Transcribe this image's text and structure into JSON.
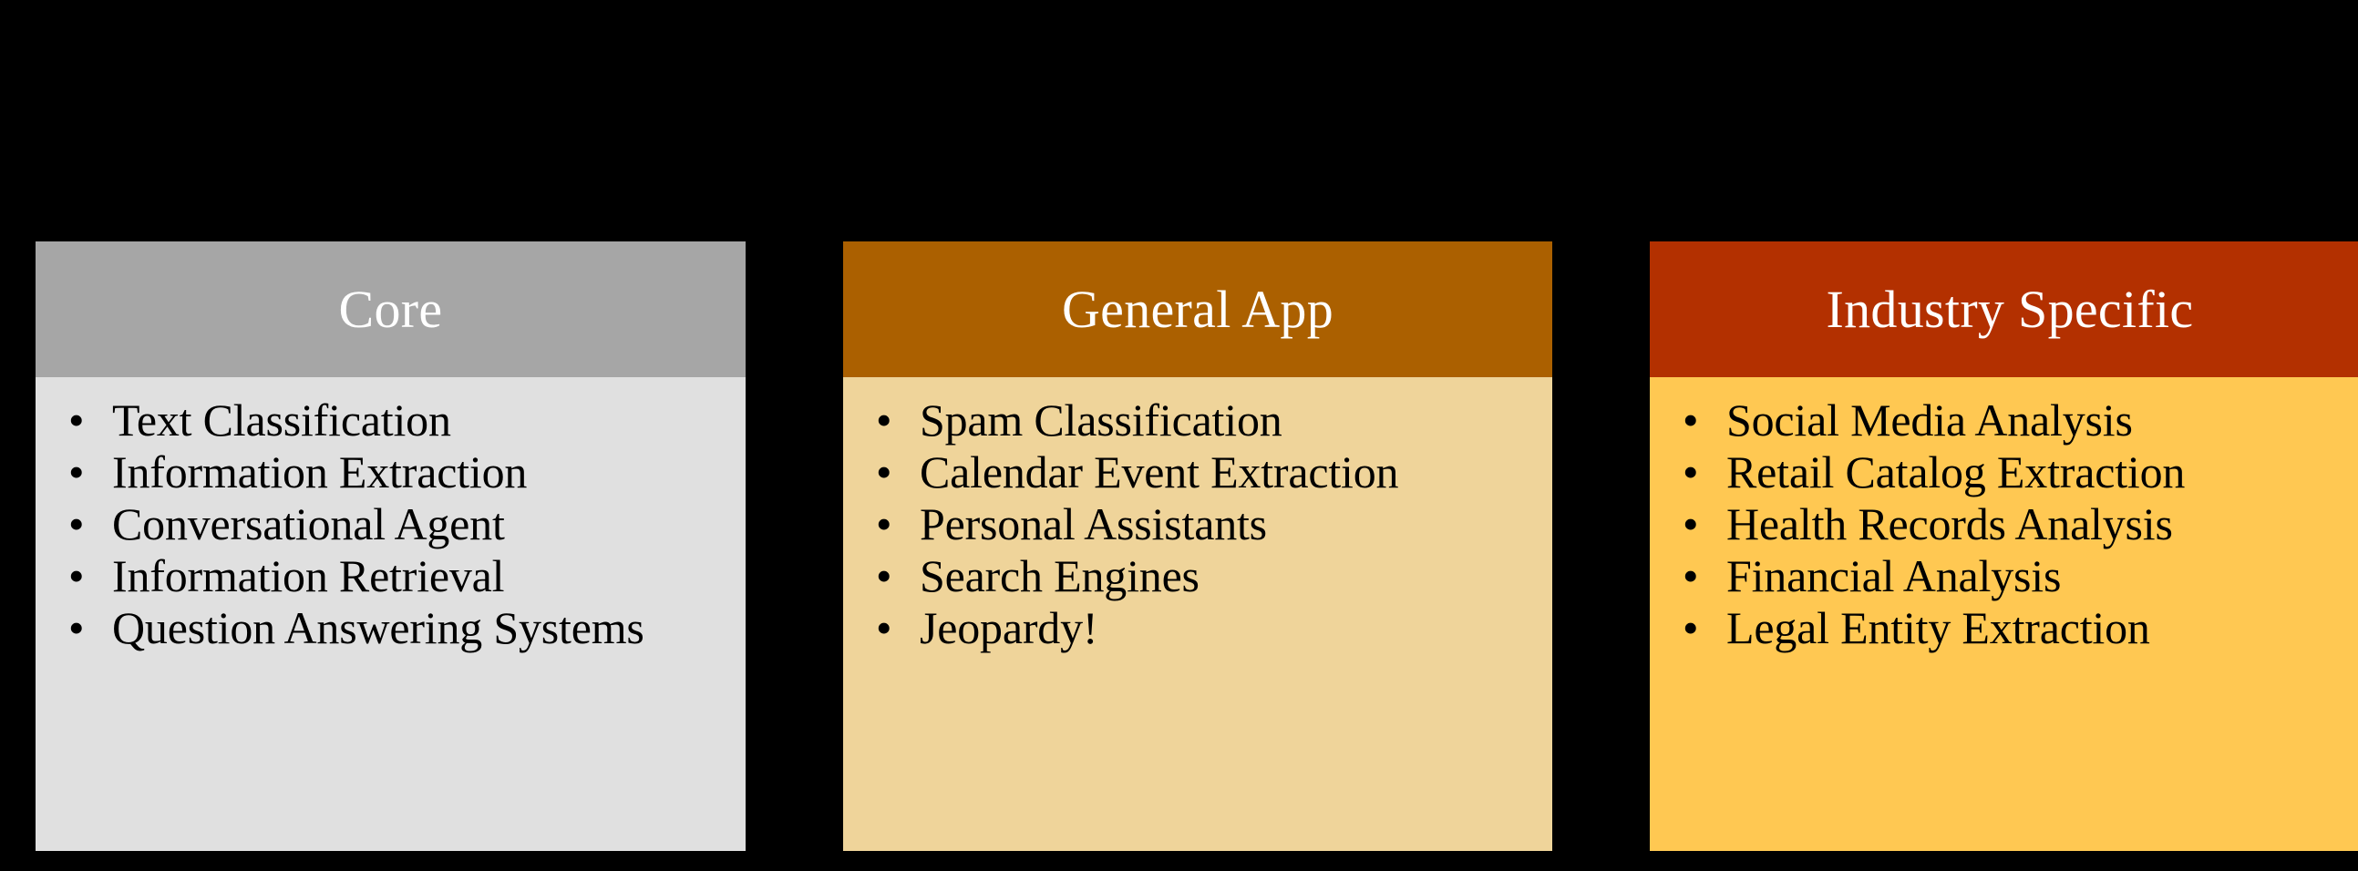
{
  "figure": {
    "background_color": "#000000",
    "bullet_glyph": "•",
    "columns": [
      {
        "id": "core",
        "title": "Core",
        "header_color": "#a6a6a6",
        "body_color": "#e0e0e0",
        "title_color": "#ffffff",
        "text_color": "#000000",
        "items": [
          "Text Classification",
          "Information Extraction",
          "Conversational Agent",
          "Information Retrieval",
          "Question Answering Systems"
        ]
      },
      {
        "id": "general-app",
        "title": "General App",
        "header_color": "#ab6000",
        "body_color": "#efd49a",
        "title_color": "#ffffff",
        "text_color": "#000000",
        "items": [
          "Spam Classification",
          "Calendar Event Extraction",
          "Personal Assistants",
          "Search Engines",
          "Jeopardy!"
        ]
      },
      {
        "id": "industry",
        "title": "Industry Specific",
        "header_color": "#b33000",
        "body_color": "#ffc852",
        "title_color": "#ffffff",
        "text_color": "#000000",
        "items": [
          "Social Media Analysis",
          "Retail Catalog Extraction",
          "Health Records Analysis",
          "Financial Analysis",
          "Legal Entity Extraction"
        ]
      }
    ]
  }
}
